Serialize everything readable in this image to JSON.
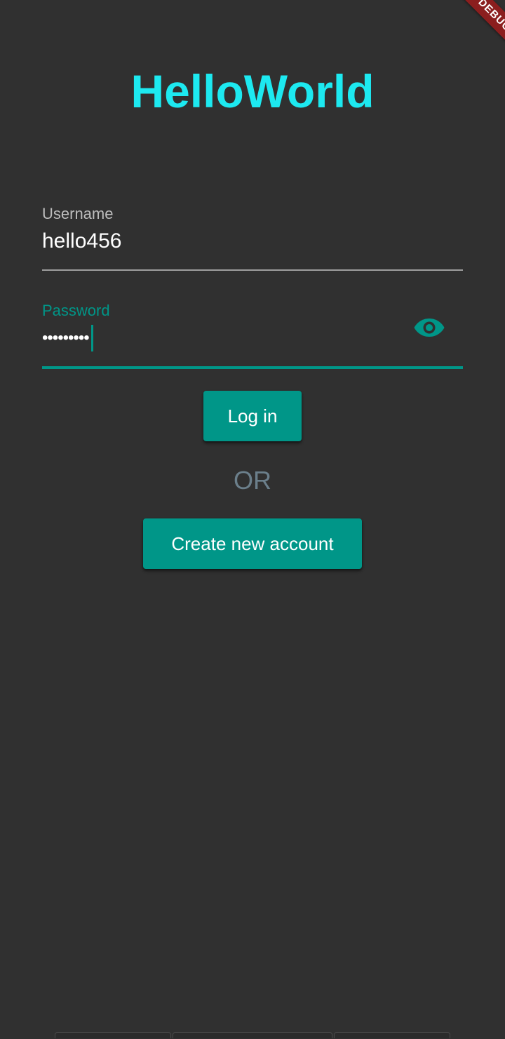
{
  "debug_banner": "DEBUG",
  "app_title": "HelloWorld",
  "username": {
    "label": "Username",
    "value": "hello456"
  },
  "password": {
    "label": "Password",
    "masked_value": "•••••••••",
    "visibility_icon": "eye-icon"
  },
  "buttons": {
    "login_label": "Log in",
    "create_account_label": "Create new account"
  },
  "or_text": "OR",
  "colors": {
    "background": "#303030",
    "accent": "#009688",
    "title": "#1de9f0",
    "or_text": "#6b7f8b",
    "debug_banner": "#8b1e1e"
  }
}
